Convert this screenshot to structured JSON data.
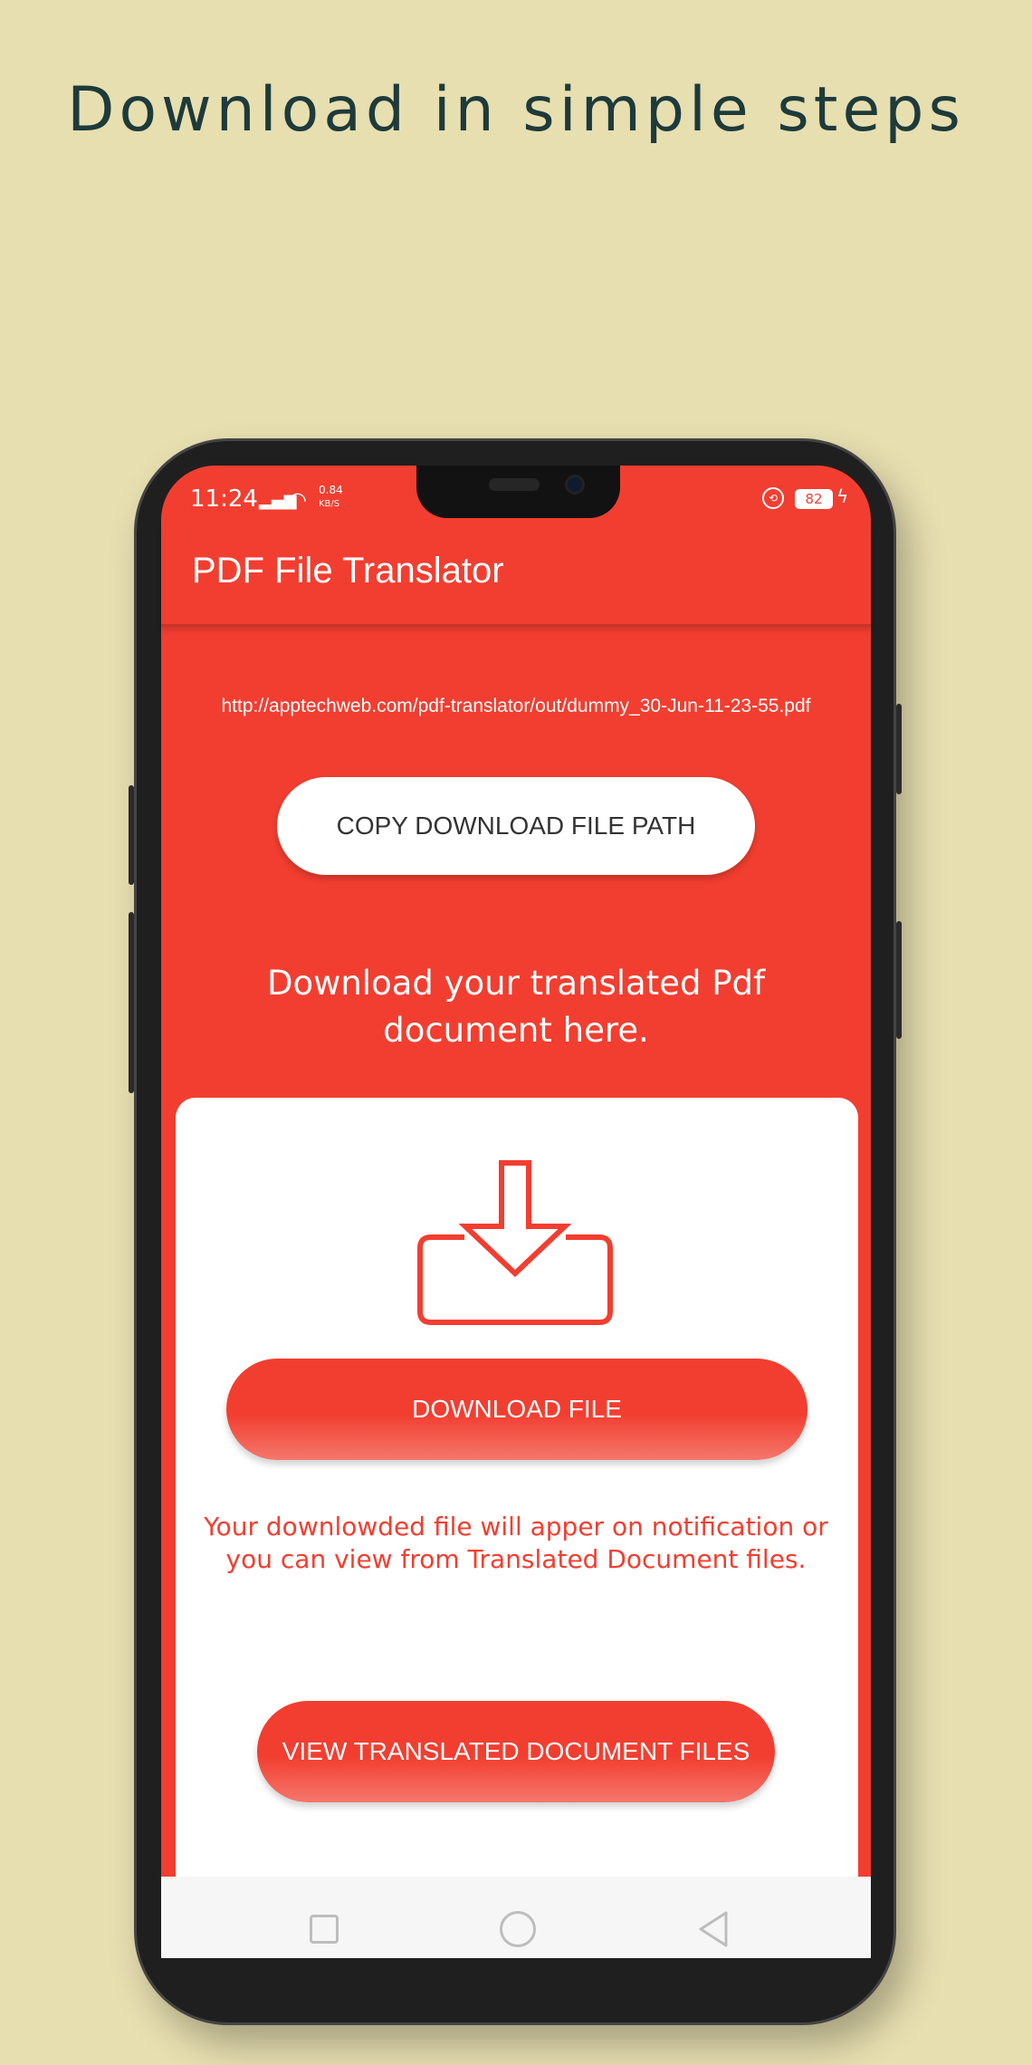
{
  "promo": {
    "headline": "Download in simple steps"
  },
  "status_bar": {
    "time": "11:24",
    "speed_value": "0.84",
    "speed_unit": "KB/S",
    "battery": "82"
  },
  "app": {
    "title": "PDF File Translator"
  },
  "content": {
    "file_url": "http://apptechweb.com/pdf-translator/out/dummy_30-Jun-11-23-55.pdf",
    "copy_button": "COPY DOWNLOAD FILE PATH",
    "heading_line1": "Download your translated Pdf",
    "heading_line2": "document here.",
    "download_button": "DOWNLOAD FILE",
    "note_line1": "Your downlowded file will apper on notification or",
    "note_line2": "you can view from Translated Document files.",
    "view_button": "VIEW TRANSLATED DOCUMENT FILES"
  },
  "icons": {
    "download": "download-tray-icon",
    "nav_recent": "square-icon",
    "nav_home": "circle-icon",
    "nav_back": "triangle-back-icon"
  },
  "colors": {
    "background": "#e7dfb0",
    "accent": "#f23e30",
    "headline": "#1e3a3a"
  }
}
